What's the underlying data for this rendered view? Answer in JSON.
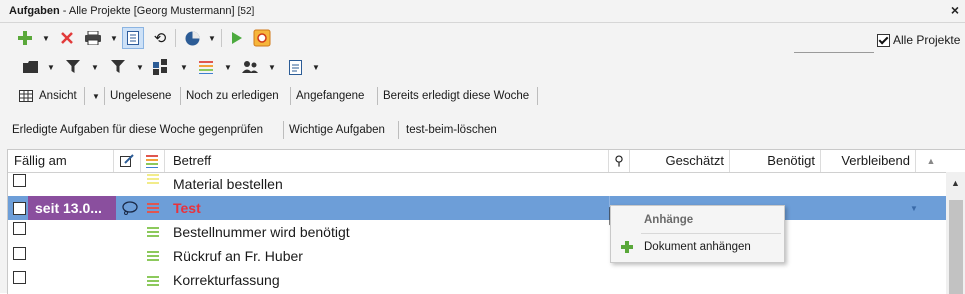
{
  "window": {
    "title_bold": "Aufgaben",
    "title_rest": " - Alle Projekte [Georg Mustermann]",
    "count": "[52]",
    "close_glyph": "×"
  },
  "toolbar1": {
    "icons": [
      "add-icon",
      "delete-icon",
      "print-icon",
      "list-view-icon",
      "refresh-icon",
      "pie-chart-icon",
      "play-icon",
      "export-icon"
    ],
    "search": {
      "value": "",
      "placeholder": ""
    },
    "all_projects_label": "Alle Projekte",
    "all_projects_checked": true
  },
  "toolbar2": {
    "icons": [
      "folder-icon",
      "filter-icon",
      "filter-alt-icon",
      "tiles-icon",
      "priority-icon",
      "users-icon",
      "document-icon"
    ]
  },
  "viewbar": {
    "items": [
      "Ansicht",
      "Ungelesene",
      "Noch zu erledigen",
      "Angefangene",
      "Bereits erledigt diese Woche"
    ]
  },
  "filterbar": {
    "items": [
      "Erledigte Aufgaben für diese Woche gegenprüfen",
      "Wichtige Aufgaben",
      "test-beim-löschen"
    ]
  },
  "grid": {
    "columns": {
      "due": "Fällig am",
      "subject": "Betreff",
      "estimated": "Geschätzt",
      "required": "Benötigt",
      "remaining": "Verbleibend"
    },
    "rows": [
      {
        "due": "",
        "subject": "Material bestellen",
        "selected": false,
        "priority_color": "#f2ec8a"
      },
      {
        "due": "seit 13.0...",
        "subject": "Test",
        "selected": true,
        "priority_color": "#e0564f"
      },
      {
        "due": "",
        "subject": "Bestellnummer wird benötigt",
        "selected": false,
        "priority_color": "#8cc95c"
      },
      {
        "due": "",
        "subject": "Rückruf an Fr. Huber",
        "selected": false,
        "priority_color": "#8cc95c"
      },
      {
        "due": "",
        "subject": "Korrekturfassung",
        "selected": false,
        "priority_color": "#8cc95c"
      }
    ]
  },
  "context_menu": {
    "header": "Anhänge",
    "item": "Dokument anhängen"
  },
  "colors": {
    "selection": "#6d9ed8",
    "due_badge": "#8a4f9e",
    "subject_red": "#e8323c"
  }
}
